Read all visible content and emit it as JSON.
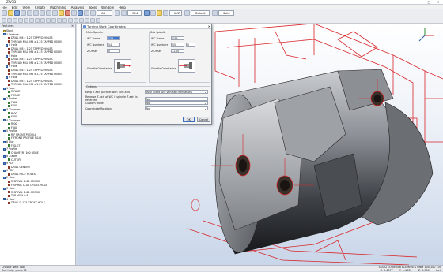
{
  "window": {
    "title": "ZW3D",
    "buttons": [
      "–",
      "□",
      "✕"
    ]
  },
  "menu": [
    "File",
    "Edit",
    "View",
    "Create",
    "Machining",
    "Analysis",
    "Tools",
    "Window",
    "Help"
  ],
  "toolbar": {
    "combo1": "G4",
    "combo2": "G14",
    "combo3": "XYZ",
    "combo4": "Default",
    "combo5": "Solid"
  },
  "features_panel": {
    "title": "Features",
    "items": [
      {
        "label": "Stock",
        "icon": "folder-icon",
        "indent": 1
      },
      {
        "label": "1 Feature",
        "icon": "feature-icon",
        "indent": 1
      },
      {
        "label": "DRILL M8 x 1.25 TAPPED HOLES",
        "icon": "drill-icon",
        "indent": 3
      },
      {
        "label": "THREAD MILL M8 x 1.25 TAPPED HOLES",
        "icon": "thread-icon",
        "indent": 3
      },
      {
        "label": "X Hole",
        "icon": "feature-icon",
        "indent": 2
      },
      {
        "label": "DRILL M8 x 1.25 TAPPED HOLES",
        "icon": "drill-icon",
        "indent": 3
      },
      {
        "label": "THREAD MILL M8 x 1.25 TAPPED HOLES",
        "icon": "thread-icon",
        "indent": 3
      },
      {
        "label": "Y Hole",
        "icon": "feature-icon",
        "indent": 2
      },
      {
        "label": "DRILL M8 x 1.25 TAPPED HOLES",
        "icon": "drill-icon",
        "indent": 3
      },
      {
        "label": "THREAD MILL M8 x 1.25 TAPPED HOLES",
        "icon": "thread-icon",
        "indent": 3
      },
      {
        "label": "Z Hole",
        "icon": "feature-icon",
        "indent": 2
      },
      {
        "label": "DRILL M8 x 1.25 TAPPED HOLES",
        "icon": "drill-icon",
        "indent": 3
      },
      {
        "label": "THREAD MILL M8 x 1.25 TAPPED HOLES",
        "icon": "thread-icon",
        "indent": 3
      },
      {
        "label": "X Hole",
        "icon": "feature-icon",
        "indent": 2
      },
      {
        "label": "DRILL M8 x 1.25 TAPPED HOLES",
        "icon": "drill-icon",
        "indent": 3
      },
      {
        "label": "THREAD MILL M8 x 1.25 TAPPED HOLES",
        "icon": "thread-icon",
        "indent": 3
      },
      {
        "label": "1 Face",
        "icon": "feature-icon",
        "indent": 1
      },
      {
        "label": "R FACE",
        "icon": "face-icon",
        "indent": 3
      },
      {
        "label": "F FACE",
        "icon": "face-icon",
        "indent": 3
      },
      {
        "label": "2 Pocket",
        "icon": "feature-icon",
        "indent": 1
      },
      {
        "label": "P 00",
        "icon": "pocket-icon",
        "indent": 3
      },
      {
        "label": "F 00",
        "icon": "pocket-icon",
        "indent": 3
      },
      {
        "label": "3 Chamfer",
        "icon": "feature-icon",
        "indent": 1
      },
      {
        "label": "R 00",
        "icon": "chamfer-icon",
        "indent": 3
      },
      {
        "label": "F 00",
        "icon": "chamfer-icon",
        "indent": 3
      },
      {
        "label": "4 Chamfer",
        "icon": "feature-icon",
        "indent": 1
      },
      {
        "label": "R 00",
        "icon": "chamfer-icon",
        "indent": 3
      },
      {
        "label": "F 00",
        "icon": "chamfer-icon",
        "indent": 3
      },
      {
        "label": "5 Profile",
        "icon": "feature-icon",
        "indent": 1
      },
      {
        "label": "R-F FRONT PROFILE",
        "icon": "profile-icon",
        "indent": 3
      },
      {
        "label": "F FRONT PROFILE R&ID",
        "icon": "profile-icon",
        "indent": 3
      },
      {
        "label": "6 Slot",
        "icon": "feature-icon",
        "indent": 1
      },
      {
        "label": "F SLOT",
        "icon": "slot-icon",
        "indent": 3
      },
      {
        "label": "7 Profile",
        "icon": "feature-icon",
        "indent": 1
      },
      {
        "label": "CHAMFER .100 BORE",
        "icon": "profile-icon",
        "indent": 3
      },
      {
        "label": "8 Cutoff",
        "icon": "feature-icon",
        "indent": 1
      },
      {
        "label": "CUTOFF",
        "icon": "cutoff-icon",
        "indent": 3
      },
      {
        "label": "9 PDF",
        "icon": "feature-icon",
        "indent": 1
      },
      {
        "label": "DRILL CENTER",
        "icon": "drill-icon",
        "indent": 3
      },
      {
        "label": "1 PDF",
        "icon": "feature-icon",
        "indent": 1
      },
      {
        "label": "DRILL FACE HOLES",
        "icon": "drill-icon",
        "indent": 3
      },
      {
        "label": "2 Hole",
        "icon": "feature-icon",
        "indent": 1
      },
      {
        "label": "R SPIRAL D.00 CROSS",
        "icon": "spiral-icon",
        "indent": 3
      },
      {
        "label": "F SPIRAL D.00 CROSS HOLE",
        "icon": "spiral-icon",
        "indent": 3
      },
      {
        "label": "3 Hole",
        "icon": "feature-icon",
        "indent": 1
      },
      {
        "label": "R SPIRAL D.00 CROSS",
        "icon": "spiral-icon",
        "indent": 3
      },
      {
        "label": "TAP M5 X 0.8",
        "icon": "tap-icon",
        "indent": 3
      },
      {
        "label": "4 Hole",
        "icon": "feature-icon",
        "indent": 1
      },
      {
        "label": "DRILL D.125 CROSS HOLE",
        "icon": "drill-icon",
        "indent": 3
      }
    ]
  },
  "dialog": {
    "title": "Turning Work Coordinates",
    "main_spindle": {
      "group_label": "Main Spindle",
      "fields": [
        {
          "label": "WC Name",
          "value": "G54",
          "selected": true
        },
        {
          "label": "WC Numbers",
          "value": "54"
        },
        {
          "label": "Z Offset",
          "value": "0"
        }
      ],
      "orientation_label": "Spindle Orientation"
    },
    "sub_spindle": {
      "group_label": "Sub Spindle",
      "fields": [
        {
          "label": "WC Name",
          "value": "G55"
        },
        {
          "label": "WC Numbers",
          "value": "55"
        },
        {
          "label": "Z Offset",
          "value": "-1.00"
        }
      ],
      "extra": [
        {
          "label": "0",
          "value": "0"
        }
      ],
      "orientation_label": "Spindle Orientation"
    },
    "options": {
      "group_label": "Options",
      "rows": [
        {
          "label": "Keep Z axis parallel with Turn axis",
          "value": "With Tilted And Vertical Orientations"
        },
        {
          "label": "Reverse Z axis of WC if spindle Z axis is reversed",
          "value": "No"
        },
        {
          "label": "Custom Mode",
          "value": "No"
        },
        {
          "label": "Coordinate Rotation",
          "value": "No"
        }
      ]
    },
    "buttons": {
      "ok": "OK",
      "cancel": "Cancel"
    }
  },
  "status": {
    "left_line1": "Choose Next Tool",
    "left_line2": "Red Help: press F1",
    "right_line": "SOLID TURN  506 ELEMENTS  ONM  100  100  100",
    "coords": [
      "X: 0.4077",
      "Y: 1.4002",
      "Z: 0.000",
      "Inch"
    ]
  }
}
